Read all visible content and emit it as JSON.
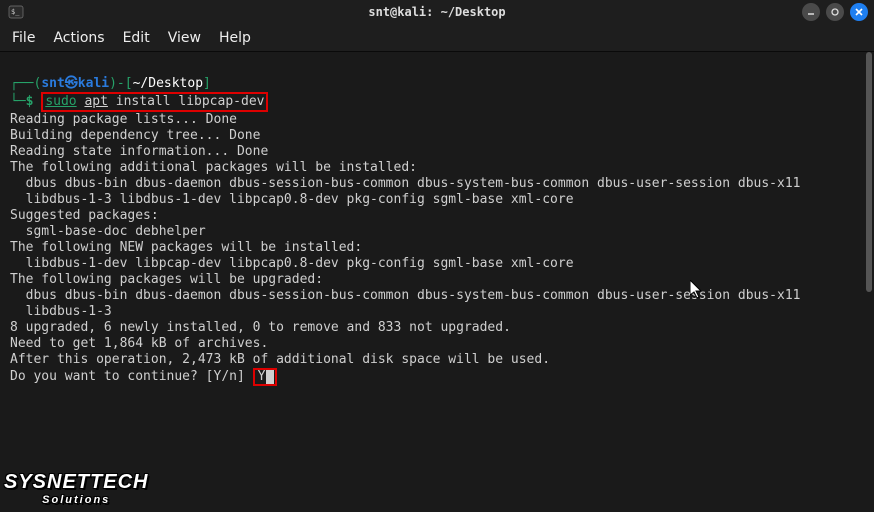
{
  "titlebar": {
    "title": "snt@kali: ~/Desktop"
  },
  "menubar": {
    "file": "File",
    "actions": "Actions",
    "edit": "Edit",
    "view": "View",
    "help": "Help"
  },
  "prompt": {
    "open": "┌──(",
    "user": "snt㉿kali",
    "sep1": ")-[",
    "cwd": "~/Desktop",
    "close": "]",
    "line2_prefix": "└─",
    "dollar": "$",
    "cmd_sudo": "sudo",
    "cmd_apt": "apt",
    "cmd_rest": " install libpcap-dev"
  },
  "lines": {
    "l1": "Reading package lists... Done",
    "l2": "Building dependency tree... Done",
    "l3": "Reading state information... Done",
    "l4": "The following additional packages will be installed:",
    "l5": "  dbus dbus-bin dbus-daemon dbus-session-bus-common dbus-system-bus-common dbus-user-session dbus-x11",
    "l6": "  libdbus-1-3 libdbus-1-dev libpcap0.8-dev pkg-config sgml-base xml-core",
    "l7": "Suggested packages:",
    "l8": "  sgml-base-doc debhelper",
    "l9": "The following NEW packages will be installed:",
    "l10": "  libdbus-1-dev libpcap-dev libpcap0.8-dev pkg-config sgml-base xml-core",
    "l11": "The following packages will be upgraded:",
    "l12": "  dbus dbus-bin dbus-daemon dbus-session-bus-common dbus-system-bus-common dbus-user-session dbus-x11",
    "l13": "  libdbus-1-3",
    "l14": "8 upgraded, 6 newly installed, 0 to remove and 833 not upgraded.",
    "l15": "Need to get 1,864 kB of archives.",
    "l16": "After this operation, 2,473 kB of additional disk space will be used.",
    "l17": "Do you want to continue? [Y/n] ",
    "answer": "Y"
  },
  "watermark": {
    "big": "SYSNETTECH",
    "small": "Solutions"
  }
}
